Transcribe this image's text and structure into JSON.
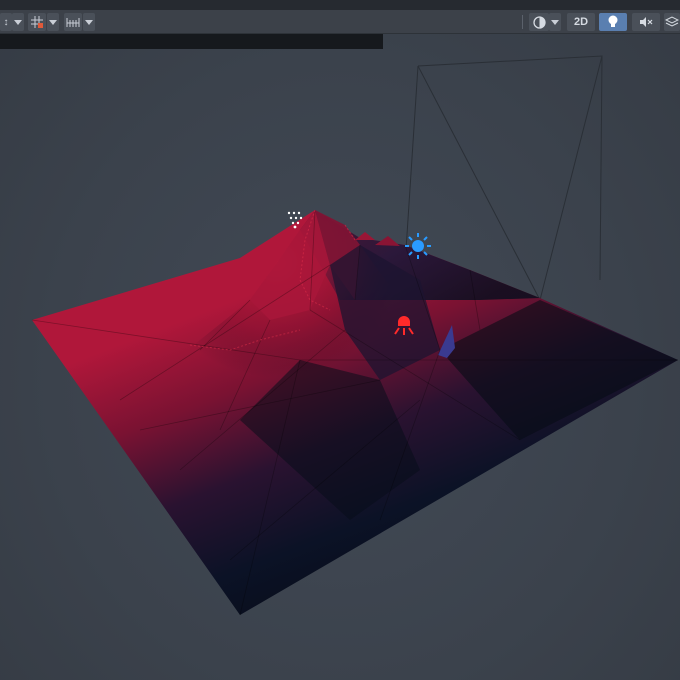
{
  "toolbar": {
    "view_2d_label": "2D",
    "buttons": [
      {
        "name": "transform-gizmo",
        "icon": "move-icon"
      },
      {
        "name": "grid-snap",
        "icon": "grid-icon"
      },
      {
        "name": "scale-snap",
        "icon": "ruler-icon"
      },
      {
        "name": "shading-mode",
        "icon": "globe-icon"
      },
      {
        "name": "view-2d",
        "icon": "text"
      },
      {
        "name": "scene-lighting",
        "icon": "lightbulb-icon",
        "active": true
      },
      {
        "name": "audio-toggle",
        "icon": "speaker-mute-icon"
      },
      {
        "name": "effects-toggle",
        "icon": "layers-icon"
      }
    ]
  },
  "scene": {
    "terrain_colors": {
      "peak": "#c01a38",
      "mid": "#6a1030",
      "base": "#0a1020",
      "far": "#14182a"
    },
    "directional_light_color": "#2a9bff",
    "point_light_color": "#ff2a2a",
    "background_color": "#3e4550",
    "objects": [
      {
        "name": "terrain-mesh",
        "icon": "mountain-icon"
      },
      {
        "name": "directional-light",
        "icon": "sun-icon"
      },
      {
        "name": "spot-light",
        "icon": "spotlight-icon"
      },
      {
        "name": "particle-system",
        "icon": "particles-icon"
      },
      {
        "name": "camera-frustum",
        "icon": "camera-icon"
      }
    ]
  }
}
